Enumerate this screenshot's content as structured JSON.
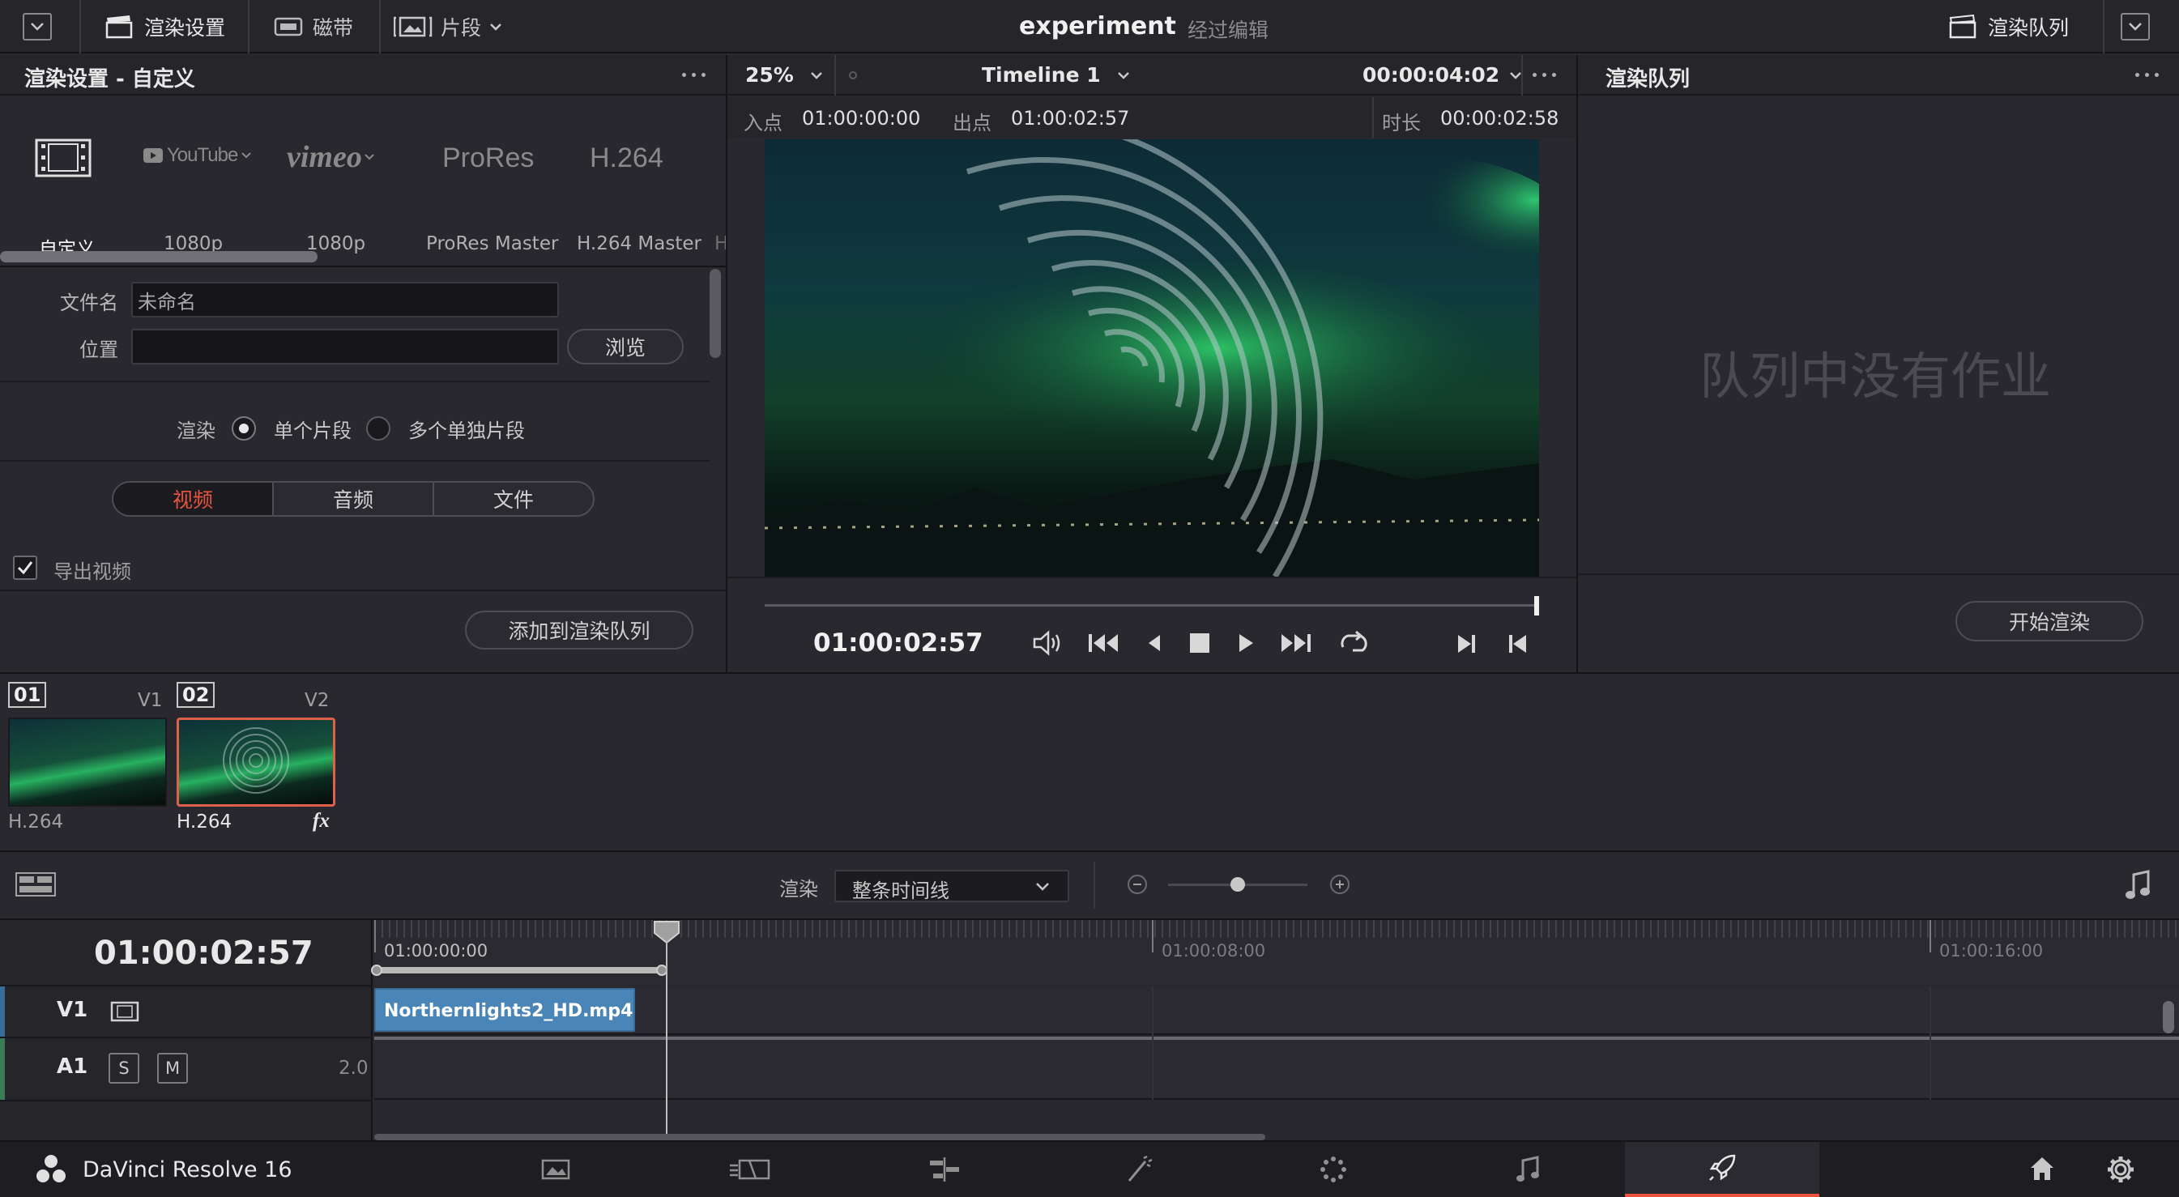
{
  "topbar": {
    "render_settings_label": "渲染设置",
    "tape_label": "磁带",
    "clips_label": "片段",
    "project_name": "experiment",
    "project_state": "经过编辑",
    "render_queue_label": "渲染队列"
  },
  "render_settings": {
    "title": "渲染设置 - 自定义",
    "presets": [
      {
        "label": "自定义",
        "logo": "film-icon"
      },
      {
        "label": "1080p",
        "logo": "YouTube"
      },
      {
        "label": "1080p",
        "logo": "vimeo"
      },
      {
        "label": "ProRes Master",
        "logo": "ProRes"
      },
      {
        "label": "H.264 Master",
        "logo": "H.264"
      },
      {
        "label": "H",
        "logo": ""
      }
    ],
    "filename_label": "文件名",
    "filename_value": "未命名",
    "location_label": "位置",
    "location_value": "",
    "browse_label": "浏览",
    "render_label": "渲染",
    "single_clip_label": "单个片段",
    "multiple_clips_label": "多个单独片段",
    "tabs": [
      "视频",
      "音频",
      "文件"
    ],
    "export_video_label": "导出视频",
    "add_to_queue_label": "添加到渲染队列"
  },
  "viewer": {
    "zoom": "25%",
    "timeline_name": "Timeline 1",
    "timecode_total": "00:00:04:02",
    "in_label": "入点",
    "in_value": "01:00:00:00",
    "out_label": "出点",
    "out_value": "01:00:02:57",
    "duration_label": "时长",
    "duration_value": "00:00:02:58",
    "current_timecode": "01:00:02:57",
    "scrub_progress": 1.0
  },
  "queue": {
    "title": "渲染队列",
    "empty_text": "队列中没有作业",
    "start_render_label": "开始渲染"
  },
  "clips": [
    {
      "number": "01",
      "track": "V1",
      "codec": "H.264",
      "fx": ""
    },
    {
      "number": "02",
      "track": "V2",
      "codec": "H.264",
      "fx": "fx"
    }
  ],
  "timeline_bar": {
    "render_label": "渲染",
    "render_mode": "整条时间线",
    "zoom_level": 0.5
  },
  "timeline": {
    "timecode": "01:00:02:57",
    "ruler_labels": [
      "01:00:00:00",
      "01:00:08:00",
      "01:00:16:00"
    ],
    "tracks": [
      {
        "name": "V1",
        "clip": "Northernlights2_HD.mp4"
      },
      {
        "name": "A1",
        "solo": "S",
        "mute": "M",
        "channels": "2.0"
      }
    ]
  },
  "bottom_nav": {
    "app_name": "DaVinci Resolve 16",
    "pages": [
      "media-icon",
      "cut-icon",
      "edit-icon",
      "fusion-icon",
      "color-icon",
      "fairlight-icon",
      "deliver-icon"
    ],
    "active_page": "deliver-icon"
  },
  "colors": {
    "accent_red": "#e9533f",
    "clip_blue": "#4a85b8",
    "selected_border": "#e0604a"
  }
}
